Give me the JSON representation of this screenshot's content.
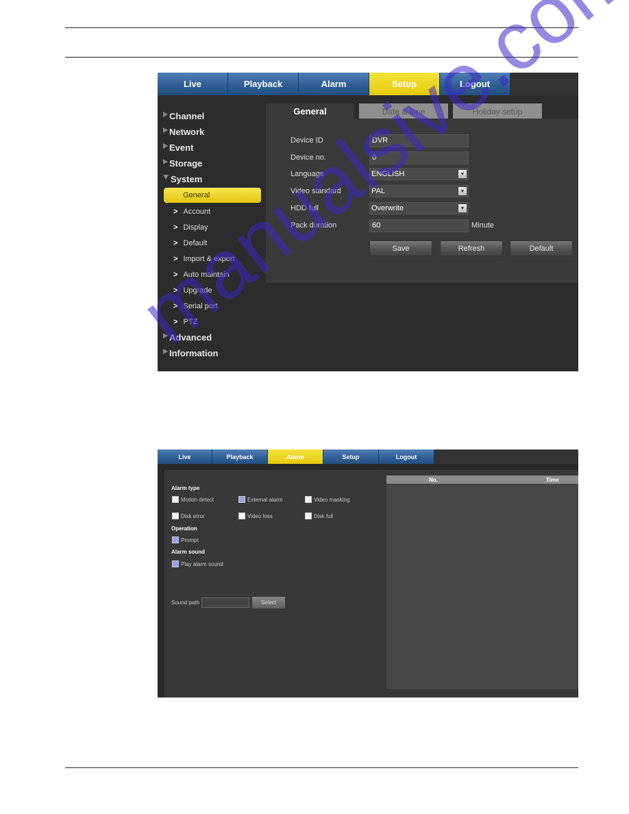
{
  "screenshot1": {
    "top_nav": [
      {
        "label": "Live",
        "active": false
      },
      {
        "label": "Playback",
        "active": false
      },
      {
        "label": "Alarm",
        "active": false
      },
      {
        "label": "Setup",
        "active": true
      },
      {
        "label": "Logout",
        "active": false
      }
    ],
    "sidebar": {
      "main_items": [
        "Channel",
        "Network",
        "Event",
        "Storage",
        "System"
      ],
      "active_sub": "General",
      "sub_items": [
        "Account",
        "Display",
        "Default",
        "Import & export",
        "Auto maintain",
        "Upgrade",
        "Serial port",
        "PTZ"
      ],
      "bottom_items": [
        "Advanced",
        "Information"
      ]
    },
    "sub_tabs": [
      {
        "label": "General",
        "active": true
      },
      {
        "label": "Date & time",
        "active": false
      },
      {
        "label": "Holiday setup",
        "active": false
      }
    ],
    "form": {
      "device_id": {
        "label": "Device ID",
        "value": "DVR"
      },
      "device_no": {
        "label": "Device no.",
        "value": "0"
      },
      "language": {
        "label": "Language",
        "value": "ENGLISH"
      },
      "video_standard": {
        "label": "Video standard",
        "value": "PAL"
      },
      "hdd_full": {
        "label": "HDD full",
        "value": "Overwrite"
      },
      "pack_duration": {
        "label": "Pack duration",
        "value": "60",
        "unit": "Minute"
      }
    },
    "buttons": {
      "save": "Save",
      "refresh": "Refresh",
      "default": "Default"
    }
  },
  "screenshot2": {
    "top_nav": [
      {
        "label": "Live",
        "active": false
      },
      {
        "label": "Playback",
        "active": false
      },
      {
        "label": "Alarm",
        "active": true
      },
      {
        "label": "Setup",
        "active": false
      },
      {
        "label": "Logout",
        "active": false
      }
    ],
    "alarm_type": {
      "title": "Alarm type",
      "options": [
        {
          "label": "Motion detect",
          "checked": false
        },
        {
          "label": "External alarm",
          "checked": true
        },
        {
          "label": "Video masking",
          "checked": false
        },
        {
          "label": "Disk error",
          "checked": false
        },
        {
          "label": "Video loss",
          "checked": false
        },
        {
          "label": "Disk full",
          "checked": false
        }
      ]
    },
    "operation": {
      "title": "Operation",
      "prompt": {
        "label": "Prompt",
        "checked": true
      }
    },
    "alarm_sound": {
      "title": "Alarm sound",
      "play": {
        "label": "Play alarm sound",
        "checked": true
      }
    },
    "sound_path": {
      "label": "Sound path",
      "value": "",
      "select_button": "Select"
    },
    "table": {
      "columns": [
        "No.",
        "Time"
      ],
      "rows": []
    }
  },
  "watermark": "manualsive.com"
}
